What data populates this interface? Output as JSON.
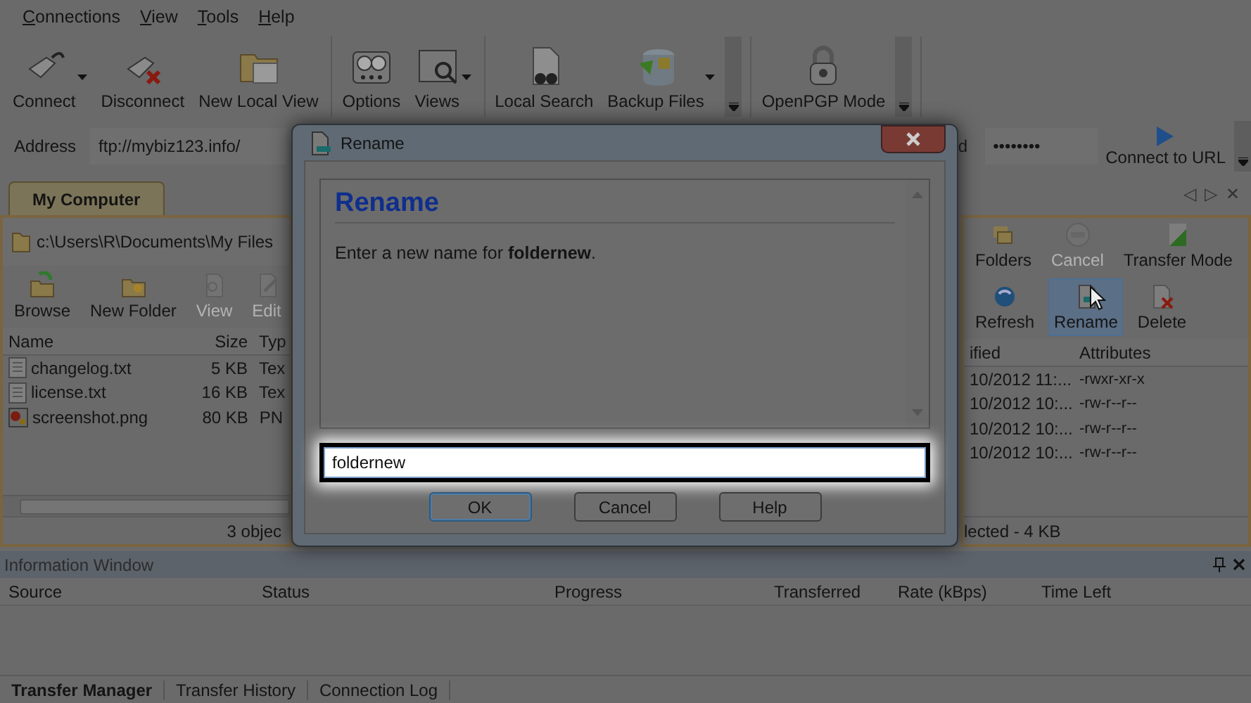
{
  "menu": [
    "Connections",
    "View",
    "Tools",
    "Help"
  ],
  "toolbar": {
    "groups": [
      [
        {
          "label": "Connect",
          "dropdown": true
        },
        {
          "label": "Disconnect",
          "dropdown": false
        },
        {
          "label": "New Local View",
          "dropdown": false
        }
      ],
      [
        {
          "label": "Options",
          "dropdown": false
        },
        {
          "label": "Views",
          "dropdown": true
        }
      ],
      [
        {
          "label": "Local Search",
          "dropdown": false
        },
        {
          "label": "Backup Files",
          "dropdown": true
        }
      ],
      [
        {
          "label": "OpenPGP Mode",
          "dropdown": false
        }
      ]
    ]
  },
  "address_bar": {
    "label": "Address",
    "value": "ftp://mybiz123.info/",
    "password_label": "d",
    "password": "••••••••",
    "connect_button": "Connect to URL"
  },
  "left_pane": {
    "tab": {
      "label": "My Computer",
      "selected": true
    },
    "path": "c:\\Users\\R\\Documents\\My Files",
    "toolbar": [
      {
        "label": "Browse",
        "disabled": false
      },
      {
        "label": "New Folder",
        "disabled": false
      },
      {
        "label": "View",
        "disabled": true
      },
      {
        "label": "Edit",
        "disabled": true
      }
    ],
    "columns": [
      "Name",
      "Size",
      "Typ"
    ],
    "rows": [
      {
        "name": "changelog.txt",
        "size": "5 KB",
        "type": "Tex",
        "kind": "text"
      },
      {
        "name": "license.txt",
        "size": "16 KB",
        "type": "Tex",
        "kind": "text"
      },
      {
        "name": "screenshot.png",
        "size": "80 KB",
        "type": "PN",
        "kind": "image"
      }
    ],
    "status": "3 objec"
  },
  "right_pane": {
    "nav": [
      "◁",
      "▷",
      "✕"
    ],
    "toolbar_1": [
      {
        "label": "Folders",
        "disabled": false
      },
      {
        "label": "Cancel",
        "disabled": true
      },
      {
        "label": "Transfer Mode",
        "disabled": false
      }
    ],
    "toolbar_2": [
      {
        "label": "Refresh",
        "disabled": false,
        "hovered": false
      },
      {
        "label": "Rename",
        "disabled": false,
        "hovered": true
      },
      {
        "label": "Delete",
        "disabled": false,
        "hovered": false
      }
    ],
    "columns": [
      "ified",
      "Attributes"
    ],
    "rows": [
      {
        "modified": "10/2012 11:...",
        "attributes": "-rwxr-xr-x"
      },
      {
        "modified": "10/2012 10:...",
        "attributes": "-rw-r--r--"
      },
      {
        "modified": "10/2012 10:...",
        "attributes": "-rw-r--r--"
      },
      {
        "modified": "10/2012 10:...",
        "attributes": "-rw-r--r--"
      }
    ],
    "status": "lected - 4 KB"
  },
  "dialog": {
    "title": "Rename",
    "heading": "Rename",
    "message": "Enter a new name for **foldernew**.",
    "value": "foldernew",
    "buttons": [
      {
        "label": "OK",
        "selected": true
      },
      {
        "label": "Cancel",
        "selected": false
      },
      {
        "label": "Help",
        "selected": false
      }
    ]
  },
  "information_window": {
    "title": "Information Window",
    "columns": [
      "Source",
      "Status",
      "Progress",
      "Transferred",
      "Rate (kBps)",
      "Time Left"
    ]
  },
  "bottom_tabs": [
    {
      "label": "Transfer Manager",
      "selected": true
    },
    {
      "label": "Transfer History",
      "selected": false
    },
    {
      "label": "Connection Log",
      "selected": false
    }
  ]
}
